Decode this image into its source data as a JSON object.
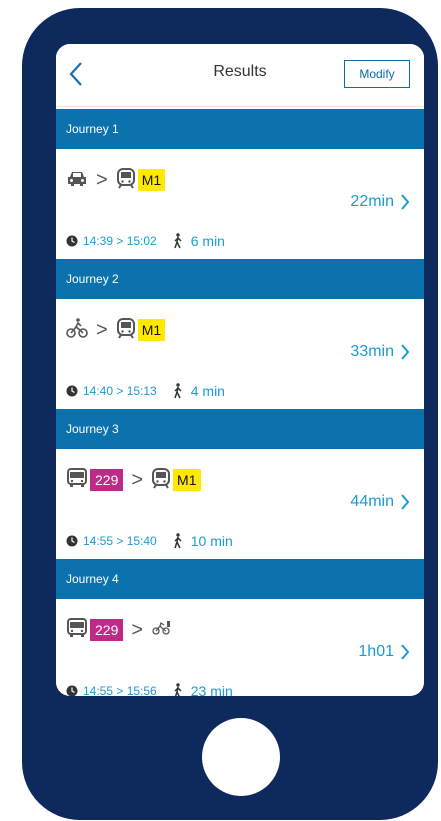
{
  "header": {
    "title": "Results",
    "modify_label": "Modify"
  },
  "journeys": [
    {
      "title": "Journey 1",
      "lines": [
        "M1"
      ],
      "duration": "22min",
      "time_range": "14:39 > 15:02",
      "walk": "6 min"
    },
    {
      "title": "Journey 2",
      "lines": [
        "M1"
      ],
      "duration": "33min",
      "time_range": "14:40 > 15:13",
      "walk": "4 min"
    },
    {
      "title": "Journey 3",
      "lines": [
        "229",
        "M1"
      ],
      "duration": "44min",
      "time_range": "14:55 > 15:40",
      "walk": "10 min"
    },
    {
      "title": "Journey 4",
      "lines": [
        "229"
      ],
      "duration": "1h01",
      "time_range": "14:55 > 15:56",
      "walk": "23 min"
    }
  ],
  "icons": {
    "back": "chevron-left-icon",
    "car": "car-icon",
    "bike": "bicycle-icon",
    "metro": "metro-icon",
    "bus": "bus-icon",
    "bikeshare": "bike-share-icon",
    "clock": "clock-icon",
    "walk": "walking-icon",
    "forward": "chevron-right-icon"
  },
  "colors": {
    "phone": "#0e2a5c",
    "header_bar": "#0c72ad",
    "accent": "#1b9bd4",
    "metro_line": "#ffe900",
    "bus_line": "#bf2a86"
  }
}
